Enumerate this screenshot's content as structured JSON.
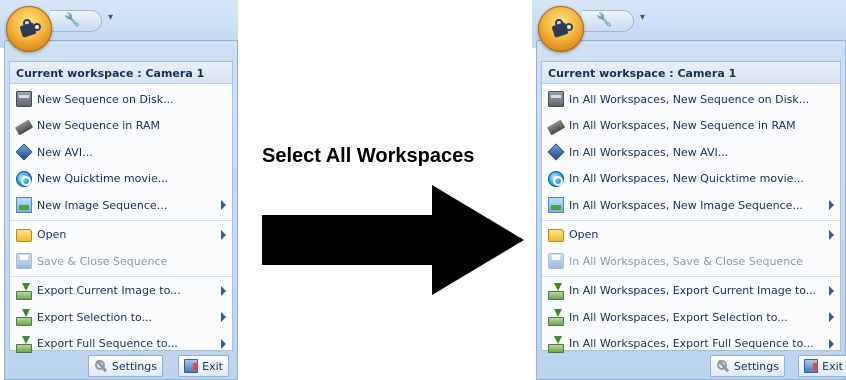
{
  "caption": "Select All Workspaces",
  "left_menu": {
    "header": "Current workspace : Camera 1",
    "items": [
      {
        "label": "New Sequence on Disk...",
        "icon": "hard-disk-icon",
        "submenu": false,
        "disabled": false
      },
      {
        "label": "New Sequence in RAM",
        "icon": "ram-icon",
        "submenu": false,
        "disabled": false
      },
      {
        "label": "New AVI...",
        "icon": "avi-icon",
        "submenu": false,
        "disabled": false
      },
      {
        "label": "New Quicktime movie...",
        "icon": "quicktime-icon",
        "submenu": false,
        "disabled": false
      },
      {
        "label": "New Image Sequence...",
        "icon": "image-sequence-icon",
        "submenu": true,
        "disabled": false
      },
      {
        "label": "Open",
        "icon": "folder-icon",
        "submenu": true,
        "disabled": false
      },
      {
        "label": "Save & Close Sequence",
        "icon": "floppy-icon",
        "submenu": false,
        "disabled": true
      },
      {
        "label": "Export Current Image to...",
        "icon": "export-icon",
        "submenu": true,
        "disabled": false
      },
      {
        "label": "Export Selection to...",
        "icon": "export-icon",
        "submenu": true,
        "disabled": false
      },
      {
        "label": "Export Full Sequence to...",
        "icon": "export-icon",
        "submenu": true,
        "disabled": false
      }
    ],
    "settings_label": "Settings",
    "exit_label": "Exit"
  },
  "right_menu": {
    "header": "Current workspace : Camera 1",
    "items": [
      {
        "label": "In All Workspaces, New Sequence on Disk...",
        "icon": "hard-disk-icon",
        "submenu": false,
        "disabled": false
      },
      {
        "label": "In All Workspaces, New Sequence in RAM",
        "icon": "ram-icon",
        "submenu": false,
        "disabled": false
      },
      {
        "label": "In All Workspaces, New AVI...",
        "icon": "avi-icon",
        "submenu": false,
        "disabled": false
      },
      {
        "label": "In All Workspaces, New Quicktime movie...",
        "icon": "quicktime-icon",
        "submenu": false,
        "disabled": false
      },
      {
        "label": "In All Workspaces, New Image Sequence...",
        "icon": "image-sequence-icon",
        "submenu": true,
        "disabled": false
      },
      {
        "label": "Open",
        "icon": "folder-icon",
        "submenu": true,
        "disabled": false
      },
      {
        "label": "In All Workspaces, Save & Close Sequence",
        "icon": "floppy-icon",
        "submenu": false,
        "disabled": true
      },
      {
        "label": "In All Workspaces, Export Current Image to...",
        "icon": "export-icon",
        "submenu": true,
        "disabled": false
      },
      {
        "label": "In All Workspaces, Export Selection to...",
        "icon": "export-icon",
        "submenu": true,
        "disabled": false
      },
      {
        "label": "In All Workspaces, Export Full Sequence to...",
        "icon": "export-icon",
        "submenu": true,
        "disabled": false
      }
    ],
    "settings_label": "Settings",
    "exit_label": "Exit"
  }
}
